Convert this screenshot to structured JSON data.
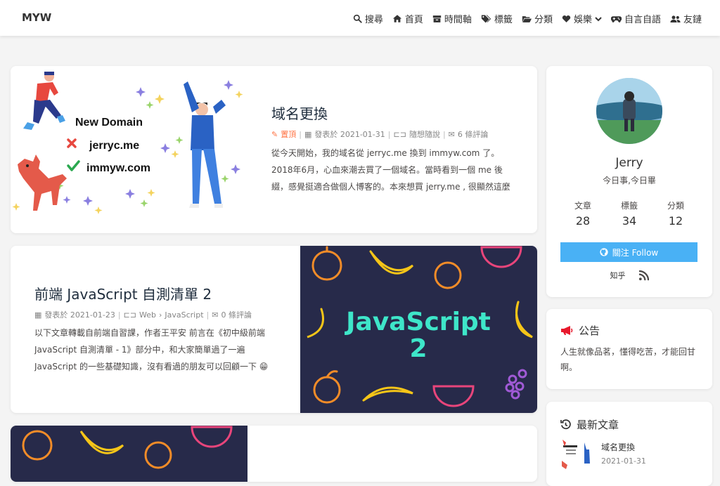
{
  "nav": {
    "brand": "MYW",
    "items": [
      {
        "label": "搜尋",
        "icon": "search-icon"
      },
      {
        "label": "首頁",
        "icon": "home-icon"
      },
      {
        "label": "時間軸",
        "icon": "archive-icon"
      },
      {
        "label": "標籤",
        "icon": "tags-icon"
      },
      {
        "label": "分類",
        "icon": "folder-open-icon"
      },
      {
        "label": "娛樂",
        "icon": "heart-icon"
      },
      {
        "label": "自言自語",
        "icon": "gamepad-icon"
      },
      {
        "label": "友鏈",
        "icon": "user-friends-icon"
      }
    ]
  },
  "posts": [
    {
      "title": "域名更換",
      "pinned": "置頂",
      "date": "發表於 2021-01-31",
      "category": "隨想隨說",
      "comments": "6 條評論",
      "excerpt": "從今天開始，我的域名從 jerryc.me 換到 immyw.com 了。 2018年6月，心血來潮去買了一個域名。當時看到一個 me 後綴，感覺挺適合做個人博客的。本來想買 jerry.me , 很顯然這麼好的域名...",
      "cover": {
        "heading": "New Domain",
        "old_domain": "jerryc.me",
        "new_domain": "immyw.com"
      }
    },
    {
      "title": "前端 JavaScript 自測清單 2",
      "date": "發表於 2021-01-23",
      "category": "Web",
      "subcategory": "JavaScript",
      "comments": "0 條評論",
      "excerpt": "以下文章轉載自前端自習課，作者王平安 前言在《初中級前端 JavaScript 自測清單 - 1》部分中，和大家簡單過了一遍 JavaScript 的一些基礎知識，沒有看過的朋友可以回顧一下 😁 本...",
      "cover": {
        "line1": "JavaScript",
        "line2": "2"
      }
    }
  ],
  "author": {
    "name": "Jerry",
    "motto": "今日事,今日畢",
    "stats": [
      {
        "label": "文章",
        "value": "28"
      },
      {
        "label": "標籤",
        "value": "34"
      },
      {
        "label": "分類",
        "value": "12"
      }
    ],
    "follow_label": "關注 Follow",
    "social_zhihu": "知乎"
  },
  "announcement": {
    "title": "公告",
    "text": "人生就像品茗，懂得吃苦，才能回甘啊。"
  },
  "recent": {
    "title": "最新文章",
    "items": [
      {
        "title": "域名更換",
        "date": "2021-01-31"
      }
    ]
  },
  "colors": {
    "accent": "#49b1f5",
    "pin": "#ff7242",
    "cover_bg": "#272a4a",
    "js_text": "#3ee6c9"
  }
}
